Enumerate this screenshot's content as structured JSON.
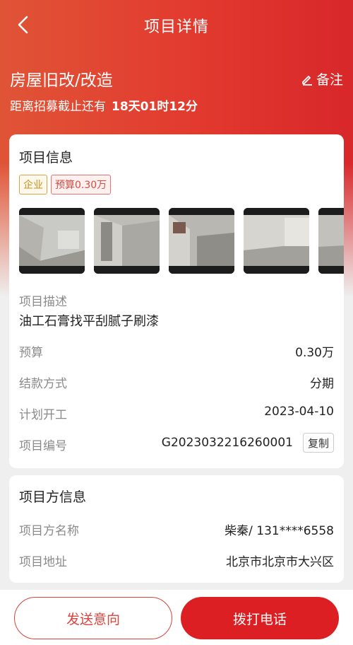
{
  "nav": {
    "title": "项目详情",
    "back_icon": "chevron-left-icon"
  },
  "project": {
    "title": "房屋旧改/改造",
    "note_label": "备注",
    "deadline_prefix": "距离招募截止还有",
    "deadline_days": "18",
    "deadline_days_unit": "天",
    "deadline_hours": "01",
    "deadline_hours_unit": "时",
    "deadline_minutes": "12",
    "deadline_minutes_unit": "分"
  },
  "info_card": {
    "title": "项目信息",
    "tags": [
      "企业",
      "预算0.30万"
    ],
    "photos": [
      "photo-1",
      "photo-2",
      "photo-3",
      "photo-4",
      "photo-5"
    ],
    "desc_label": "项目描述",
    "desc_value": "油工石膏找平刮腻子刷漆",
    "rows": [
      {
        "label": "预算",
        "value": "0.30万"
      },
      {
        "label": "结款方式",
        "value": "分期"
      },
      {
        "label": "计划开工",
        "value": "2023-04-10"
      },
      {
        "label": "项目编号",
        "value": "G2023032216260001"
      }
    ],
    "copy_label": "复制"
  },
  "owner_card": {
    "title": "项目方信息",
    "rows": [
      {
        "label": "项目方名称",
        "value": "柴秦/ 131****6558"
      },
      {
        "label": "项目地址",
        "value": "北京市北京市大兴区"
      }
    ]
  },
  "actions": {
    "send_intent": "发送意向",
    "call": "拨打电话"
  },
  "colors": {
    "accent": "#dc1f22",
    "header_start": "#e05436",
    "header_end": "#d8272a"
  }
}
